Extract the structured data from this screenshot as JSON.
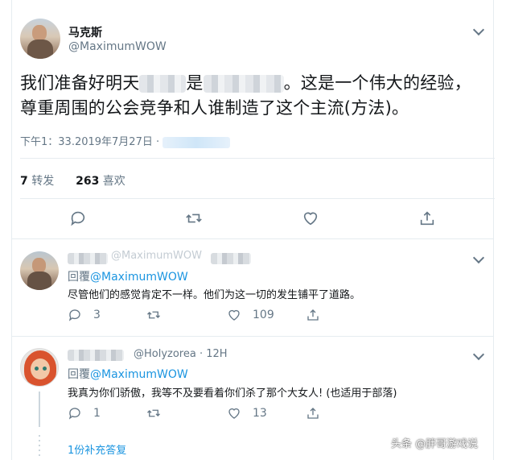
{
  "tweet": {
    "display_name": "马克斯",
    "handle": "@MaximumWOW",
    "text_line1_start": "我们准备好明天",
    "text_line1_mid": "是",
    "text_line1_end": "。这是一个伟大的经验，",
    "text_line2": "尊重周围的公会竞争和人谁制造了这个主流(方法)。",
    "timestamp": "下午1：33.2019年7月27日 ·",
    "retweets_count": "7",
    "retweets_label": "转发",
    "likes_count": "263",
    "likes_label": "喜欢"
  },
  "replies": [
    {
      "handle_partial": "@MaximumWOW",
      "reply_to_prefix": "回覆",
      "reply_to_mention": "@MaximumWOW",
      "text": "尽管他们的感觉肯定不一样。他们为这一切的发生铺平了道路。",
      "reply_count": "3",
      "like_count": "109"
    },
    {
      "handle": "@Holyzorea · 12H",
      "reply_to_prefix": "回覆",
      "reply_to_mention": "@MaximumWOW",
      "text": "我真为你们骄傲，我等不及要看着你们杀了那个大女人! (也适用于部落)",
      "reply_count": "1",
      "like_count": "13"
    }
  ],
  "more_replies": "1份补充答复",
  "watermark": "头条 @胖哥游戏说",
  "icons": [
    "reply-icon",
    "retweet-icon",
    "like-icon",
    "share-icon",
    "chevron-down-icon"
  ],
  "colors": {
    "link": "#1b95e0",
    "muted": "#657786",
    "text": "#14171a",
    "border": "#e6ecf0"
  }
}
